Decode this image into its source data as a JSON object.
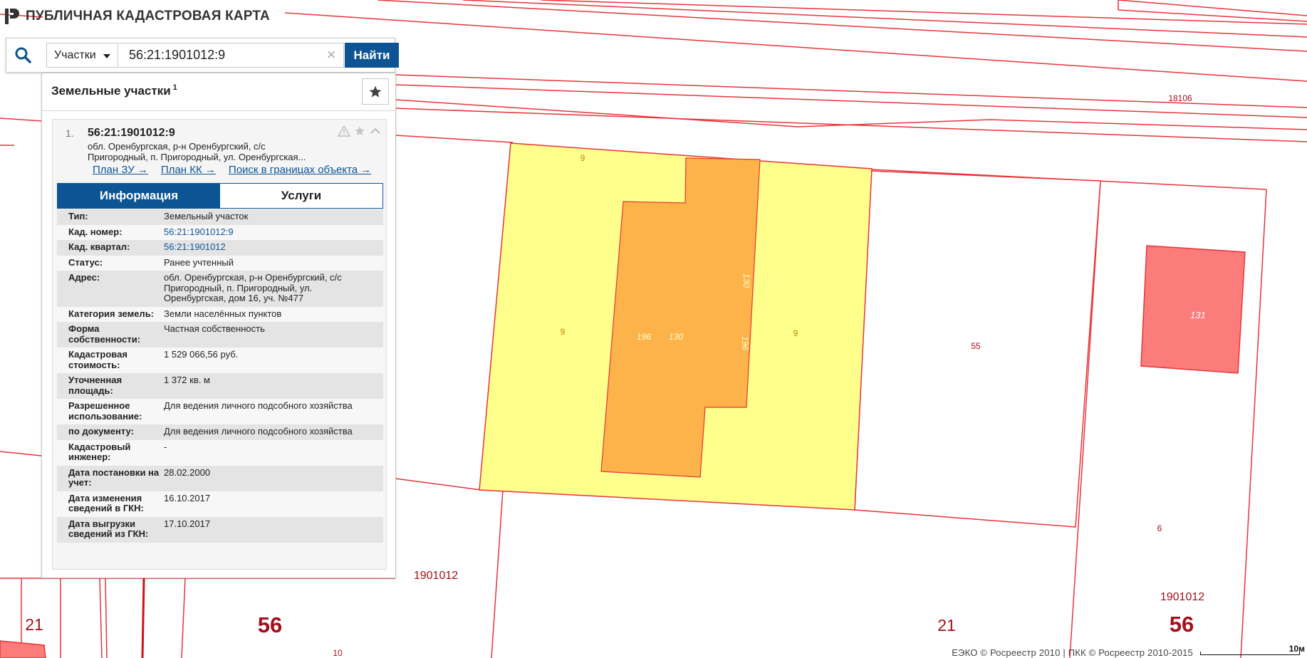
{
  "brand": {
    "title": "ПУБЛИЧНАЯ КАДАСТРОВАЯ КАРТА"
  },
  "search": {
    "type_value": "Участки",
    "query": "56:21:1901012:9",
    "clear_symbol": "×",
    "submit_label": "Найти"
  },
  "results": {
    "title": "Земельные участки",
    "count": "1",
    "item": {
      "index": "1.",
      "cad_number": "56:21:1901012:9",
      "address_line1": "обл. Оренбургская, р-н Оренбургский, с/с",
      "address_line2": "Пригородный, п. Пригородный, ул. Оренбургская...",
      "links": [
        "План ЗУ →",
        "План КК →",
        "Поиск в границах объекта →"
      ],
      "tabs": [
        "Информация",
        "Услуги"
      ],
      "rows": [
        {
          "k": "Тип:",
          "v": "Земельный участок"
        },
        {
          "k": "Кад. номер:",
          "v": "56:21:1901012:9"
        },
        {
          "k": "Кад. квартал:",
          "v": "56:21:1901012"
        },
        {
          "k": "Статус:",
          "v": "Ранее учтенный"
        },
        {
          "k": "Адрес:",
          "v": "обл. Оренбургская, р-н Оренбургский, с/с Пригородный, п. Пригородный, ул. Оренбургская, дом 16, уч. №477"
        },
        {
          "k": "Категория земель:",
          "v": "Земли населённых пунктов"
        },
        {
          "k": "Форма собственности:",
          "v": "Частная собственность"
        },
        {
          "k": "Кадастровая стоимость:",
          "v": "1 529 066,56 руб."
        },
        {
          "k": "Уточненная площадь:",
          "v": "1 372 кв. м"
        },
        {
          "k": "Разрешенное использование:",
          "v": "Для ведения личного подсобного хозяйства"
        },
        {
          "k": "по документу:",
          "v": "Для ведения личного подсобного хозяйства"
        },
        {
          "k": "Кадастровый инженер:",
          "v": "-"
        },
        {
          "k": "Дата постановки на учет:",
          "v": "28.02.2000"
        },
        {
          "k": "Дата изменения сведений в ГКН:",
          "v": "16.10.2017"
        },
        {
          "k": "Дата выгрузки сведений из ГКН:",
          "v": "17.10.2017"
        }
      ]
    }
  },
  "map": {
    "labels": {
      "road": "18106",
      "yellow_top": "9",
      "yellow_left": "9",
      "yellow_right": "9",
      "building_a": "196",
      "building_b": "130",
      "building_c": "130",
      "building_d": "196",
      "parcel_55": "55",
      "red_parcel": "131",
      "parcel_6": "6",
      "parcel_10": "10",
      "quarter_left": "1901012",
      "quarter_right": "1901012",
      "district_left": "21",
      "region_left": "56",
      "district_right": "21",
      "region_right": "56"
    },
    "colors": {
      "boundary": "#e8343a",
      "parcel_fill": "#ffff8c",
      "building_fill": "#fbb34a",
      "red_parcel_fill": "#fc7c7c",
      "label_dark_red": "#a3101a"
    }
  },
  "footer": {
    "attribution": "ЕЭКО © Росреестр 2010 | ПКК © Росреестр 2010-2015",
    "scale": "10м"
  }
}
